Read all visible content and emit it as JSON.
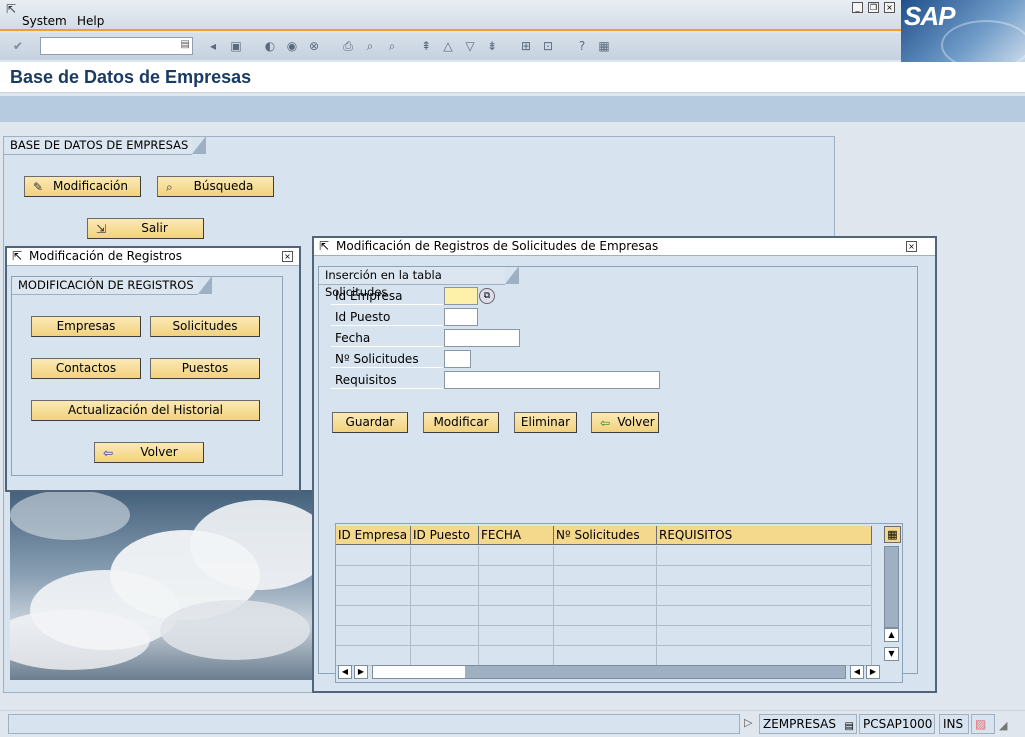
{
  "menubar": {
    "items": [
      {
        "label": "System"
      },
      {
        "label": "Help"
      }
    ]
  },
  "logo": {
    "text": "SAP"
  },
  "toolbar": {
    "command_value": ""
  },
  "page": {
    "title": "Base de Datos de Empresas"
  },
  "main": {
    "group_title": "BASE DE DATOS DE EMPRESAS",
    "buttons": {
      "modificacion": "Modificación",
      "busqueda": "Búsqueda",
      "salir": "Salir"
    }
  },
  "popup_registros": {
    "title": "Modificación de Registros",
    "group_title": "MODIFICACIÓN DE REGISTROS",
    "buttons": {
      "empresas": "Empresas",
      "solicitudes": "Solicitudes",
      "contactos": "Contactos",
      "puestos": "Puestos",
      "historial": "Actualización del Historial",
      "volver": "Volver"
    }
  },
  "popup_solicitudes": {
    "title": "Modificación de Registros de Solicitudes de Empresas",
    "group_title": "Inserción en la tabla Solicitudes",
    "fields": [
      {
        "label": "Id Empresa",
        "value": ""
      },
      {
        "label": "Id Puesto",
        "value": ""
      },
      {
        "label": "Fecha",
        "value": ""
      },
      {
        "label": "Nº Solicitudes",
        "value": ""
      },
      {
        "label": "Requisitos",
        "value": ""
      }
    ],
    "buttons": {
      "guardar": "Guardar",
      "modificar": "Modificar",
      "eliminar": "Eliminar",
      "volver": "Volver"
    },
    "table": {
      "columns": [
        "ID Empresa",
        "ID Puesto",
        "FECHA",
        "Nº Solicitudes",
        "REQUISITOS"
      ]
    }
  },
  "statusbar": {
    "program": "ZEMPRESAS",
    "server": "PCSAP1000",
    "mode": "INS"
  },
  "colors": {
    "accent": "#f1a02c",
    "button": "#f4d88c",
    "panel": "#d7e3ef",
    "title": "#1a3b63"
  }
}
